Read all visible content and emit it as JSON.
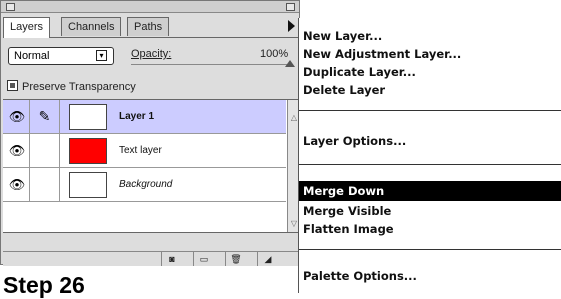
{
  "palette": {
    "tabs": [
      {
        "label": "Layers",
        "active": true
      },
      {
        "label": "Channels",
        "active": false
      },
      {
        "label": "Paths",
        "active": false
      }
    ],
    "blend_mode": "Normal",
    "opacity_label": "Opacity:",
    "opacity_value": "100%",
    "preserve_label": "Preserve Transparency",
    "layers": [
      {
        "name": "Layer 1",
        "selected": true,
        "thumb_color": "#ffffff",
        "style": "bold"
      },
      {
        "name": "Text layer",
        "selected": false,
        "thumb_color": "#ff0000",
        "style": "normal"
      },
      {
        "name": "Background",
        "selected": false,
        "thumb_color": "#ffffff",
        "style": "italic"
      }
    ],
    "eye_icon": "eye-icon",
    "brush_icon": "paintbrush-icon"
  },
  "caption": "Step 26",
  "menu": {
    "items": [
      {
        "label": "New Layer...",
        "highlighted": false
      },
      {
        "label": "New Adjustment Layer...",
        "highlighted": false
      },
      {
        "label": "Duplicate Layer...",
        "highlighted": false
      },
      {
        "label": "Delete Layer",
        "highlighted": false
      },
      {
        "label": "Layer Options...",
        "highlighted": false
      },
      {
        "label": "Merge Down",
        "highlighted": true
      },
      {
        "label": "Merge Visible",
        "highlighted": false
      },
      {
        "label": "Flatten Image",
        "highlighted": false
      },
      {
        "label": "Palette Options...",
        "highlighted": false
      }
    ]
  },
  "colors": {
    "selected_row": "#ccccff",
    "highlight": "#000000"
  }
}
